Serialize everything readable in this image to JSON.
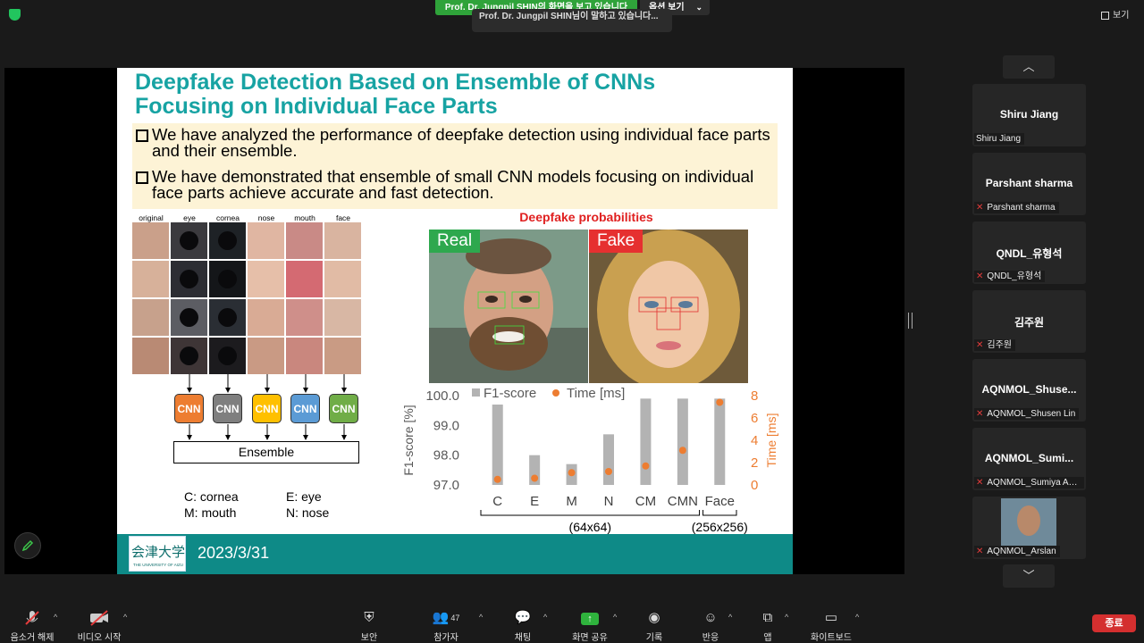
{
  "meeting": {
    "share_banner": "Prof. Dr. Jungpil SHIN의 화면을 보고 있습니다",
    "view_options_label": "옵션 보기",
    "talking_indicator": "Prof. Dr. Jungpil SHIN님이 말하고 있습니다...",
    "view_label": "보기"
  },
  "slide": {
    "title_line1": "Deepfake Detection Based on Ensemble of CNNs",
    "title_line2": "Focusing on Individual Face Parts",
    "bullets": [
      "We have analyzed the performance of deepfake detection using individual face parts and their ensemble.",
      "We have demonstrated that ensemble of small CNN models focusing on individual face parts achieve accurate and fast detection."
    ],
    "face_columns": [
      "original",
      "eye",
      "cornea",
      "nose",
      "mouth",
      "face"
    ],
    "cnn_blocks": [
      {
        "label": "CNN",
        "color": "#ed7d31"
      },
      {
        "label": "CNN",
        "color": "#7f7f7f"
      },
      {
        "label": "CNN",
        "color": "#ffc000"
      },
      {
        "label": "CNN",
        "color": "#5b9bd5"
      },
      {
        "label": "CNN",
        "color": "#70ad47"
      }
    ],
    "ensemble_label": "Ensemble",
    "legend": {
      "c": "C: cornea",
      "e": "E: eye",
      "m": "M: mouth",
      "n": "N: nose"
    },
    "deepfake_title": "Deepfake probabilities",
    "real_label": "Real",
    "fake_label": "Fake",
    "footer": {
      "logo_text": "会津大学",
      "logo_sub": "THE UNIVERSITY OF AIZU",
      "date": "2023/3/31"
    }
  },
  "chart_data": {
    "type": "bar",
    "categories": [
      "C",
      "E",
      "M",
      "N",
      "CM",
      "CMN",
      "Face"
    ],
    "series": [
      {
        "name": "F1-score",
        "values": [
          99.7,
          98.0,
          97.7,
          98.7,
          99.9,
          99.9,
          99.9
        ],
        "color": "#b3b3b3"
      },
      {
        "name": "Time [ms]",
        "values": [
          0.5,
          0.6,
          1.1,
          1.2,
          1.7,
          3.1,
          7.4
        ],
        "color": "#ed7d31"
      }
    ],
    "ylabel": "F1-score [%]",
    "y2label": "Time [ms]",
    "ylim": [
      97.0,
      100.0
    ],
    "y2lim": [
      0,
      8
    ],
    "yticks": [
      "100.0",
      "99.0",
      "98.0",
      "97.0"
    ],
    "y2ticks": [
      "8",
      "6",
      "4",
      "2",
      "0"
    ],
    "groups": [
      {
        "label": "(64x64)",
        "from": 0,
        "to": 5
      },
      {
        "label": "(256x256)",
        "from": 6,
        "to": 6
      }
    ],
    "legend_position": "top"
  },
  "participants": [
    {
      "name": "Shiru Jiang",
      "label": "Shiru Jiang",
      "muted": false
    },
    {
      "name": "Parshant sharma",
      "label": "Parshant sharma",
      "muted": true
    },
    {
      "name": "QNDL_유형석",
      "label": "QNDL_유형석",
      "muted": true
    },
    {
      "name": "김주원",
      "label": "김주원",
      "muted": true
    },
    {
      "name": "AQNMOL_Shuse...",
      "label": "AQNMOL_Shusen Lin",
      "muted": true
    },
    {
      "name": "AQNMOL_Sumi...",
      "label": "AQNMOL_Sumiya Akt...",
      "muted": true
    },
    {
      "name": "",
      "label": "AQNMOL_Arslan",
      "muted": true
    }
  ],
  "toolbar": {
    "unmute": "음소거 해제",
    "start_video": "비디오 시작",
    "security": "보안",
    "participants": "참가자",
    "participants_count": "47",
    "chat": "채팅",
    "share_screen": "화면 공유",
    "record": "기록",
    "reactions": "반응",
    "apps": "앱",
    "whiteboard": "화이트보드",
    "end": "종료"
  }
}
